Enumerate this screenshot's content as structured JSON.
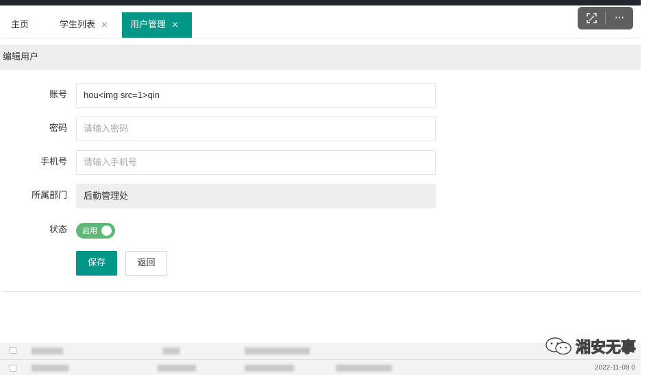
{
  "tabs": [
    {
      "label": "主页",
      "closable": false,
      "active": false
    },
    {
      "label": "学生列表",
      "closable": true,
      "active": false
    },
    {
      "label": "用户管理",
      "closable": true,
      "active": true
    }
  ],
  "tab_close_glyph": "×",
  "toolbar": {
    "expand_icon": "expand-icon",
    "more_icon": "more-icon",
    "more_glyph": "···"
  },
  "panel": {
    "title": "编辑用户"
  },
  "form": {
    "account": {
      "label": "账号",
      "value": "hou<img src=1>qin"
    },
    "password": {
      "label": "密码",
      "placeholder": "请输入密码"
    },
    "phone": {
      "label": "手机号",
      "placeholder": "请输入手机号"
    },
    "department": {
      "label": "所属部门",
      "value": "后勤管理处"
    },
    "status": {
      "label": "状态",
      "switch_text": "启用",
      "enabled": true
    }
  },
  "buttons": {
    "save": "保存",
    "back": "返回"
  },
  "watermark": {
    "text": "湘安无事"
  },
  "footer": {
    "date": "2022-11-08 0"
  },
  "colors": {
    "primary": "#009688",
    "switch_on": "#5fb878",
    "topbar": "#23262e",
    "panel_header": "#eeeeee"
  }
}
